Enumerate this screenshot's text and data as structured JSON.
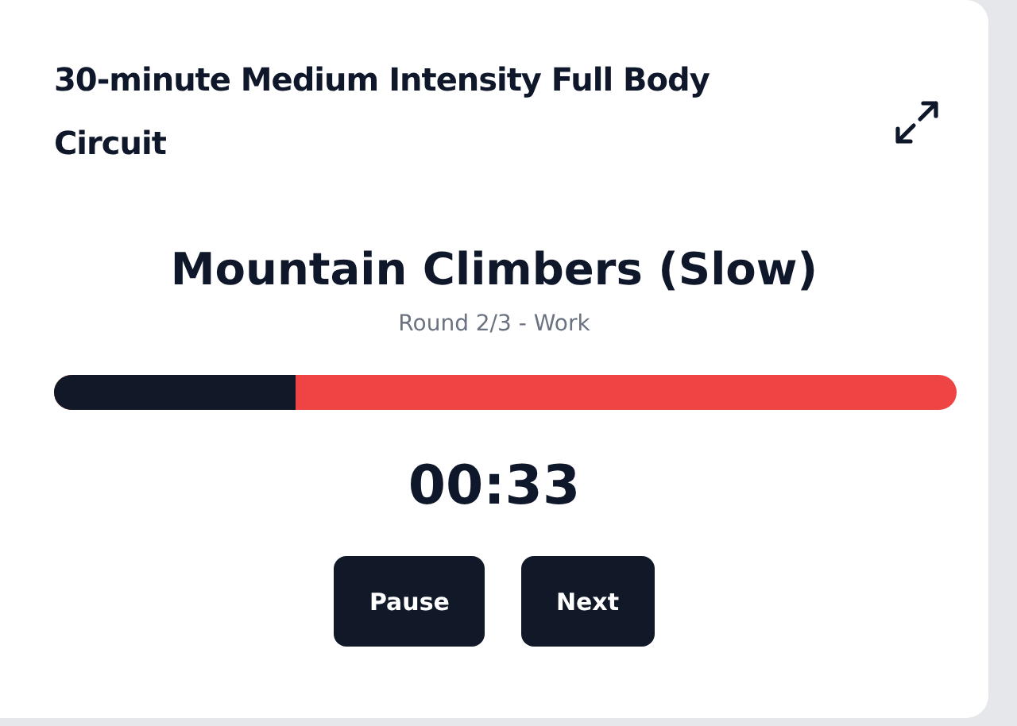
{
  "workout": {
    "title": "30-minute Medium Intensity Full Body Circuit"
  },
  "exercise": {
    "name": "Mountain Climbers (Slow)",
    "status": "Round 2/3 - Work"
  },
  "progress": {
    "level": 0.268
  },
  "timer": "00:33",
  "buttons": [
    "Pause",
    "Next"
  ]
}
